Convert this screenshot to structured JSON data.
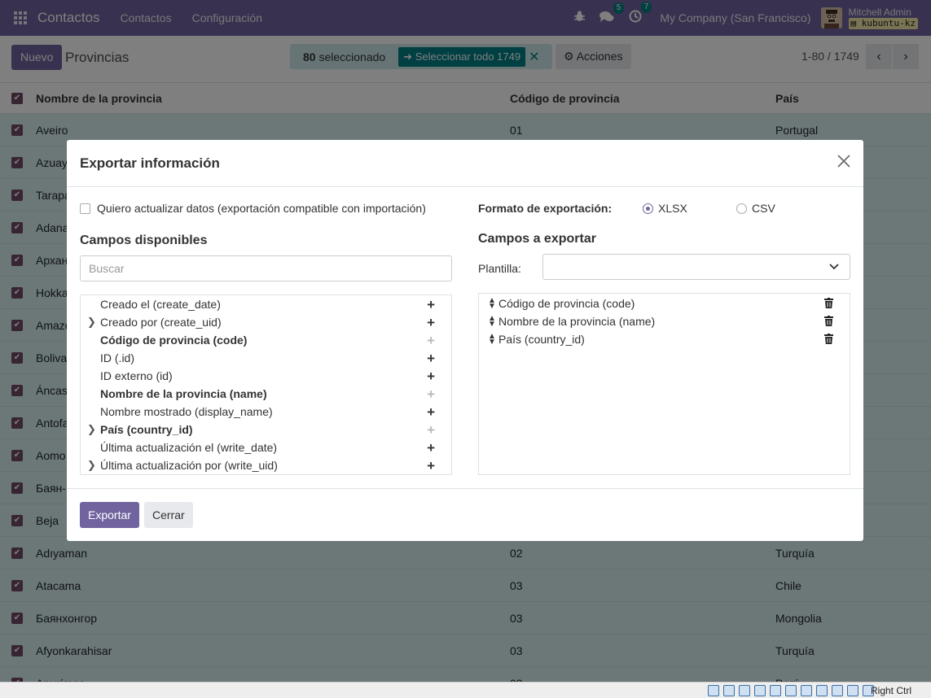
{
  "navbar": {
    "brand": "Contactos",
    "menu": [
      "Contactos",
      "Configuración"
    ],
    "messages_count": "5",
    "activities_count": "7",
    "company": "My Company (San Francisco)",
    "user_name": "Mitchell Admin",
    "database": "kubuntu-kz",
    "accent_color": "#71639e"
  },
  "control": {
    "new_label": "Nuevo",
    "breadcrumb": "Provincias",
    "selected_count": "80",
    "selected_text": "seleccionado",
    "select_all_label": "Seleccionar todo 1749",
    "actions_label": "Acciones",
    "pager_value": "1-80 / 1749"
  },
  "list": {
    "headers": [
      "Nombre de la provincia",
      "Código de provincia",
      "País"
    ],
    "rows": [
      [
        "Aveiro",
        "01",
        "Portugal"
      ],
      [
        "Azuay",
        "",
        ""
      ],
      [
        "Tarapa",
        "",
        ""
      ],
      [
        "Adana",
        "",
        ""
      ],
      [
        "Архан",
        "",
        ""
      ],
      [
        "Hokka",
        "",
        ""
      ],
      [
        "Amazo",
        "",
        ""
      ],
      [
        "Boliva",
        "",
        ""
      ],
      [
        "Áncas",
        "",
        ""
      ],
      [
        "Antofa",
        "",
        ""
      ],
      [
        "Aomo",
        "",
        ""
      ],
      [
        "Баян-",
        "",
        ""
      ],
      [
        "Beja",
        "",
        ""
      ],
      [
        "Adıyaman",
        "02",
        "Turquía"
      ],
      [
        "Atacama",
        "03",
        "Chile"
      ],
      [
        "Баянхонгор",
        "03",
        "Mongolia"
      ],
      [
        "Afyonkarahisar",
        "03",
        "Turquía"
      ],
      [
        "Apurímac",
        "03",
        "Perú"
      ]
    ]
  },
  "modal": {
    "title": "Exportar información",
    "import_compat_label": "Quiero actualizar datos (exportación compatible con importación)",
    "format_label": "Formato de exportación:",
    "format_options": [
      "XLSX",
      "CSV"
    ],
    "available_title": "Campos disponibles",
    "search_placeholder": "Buscar",
    "available_fields": [
      "Creado el (create_date)",
      "Creado por (create_uid)",
      "Código de provincia (code)",
      "ID (.id)",
      "ID externo (id)",
      "Nombre de la provincia (name)",
      "Nombre mostrado (display_name)",
      "País (country_id)",
      "Última actualización el (write_date)",
      "Última actualización por (write_uid)"
    ],
    "export_title": "Campos a exportar",
    "template_label": "Plantilla:",
    "export_fields": [
      "Código de provincia (code)",
      "Nombre de la provincia (name)",
      "País (country_id)"
    ],
    "export_button": "Exportar",
    "close_button": "Cerrar"
  },
  "statusbar": {
    "host_key": "Right Ctrl"
  }
}
